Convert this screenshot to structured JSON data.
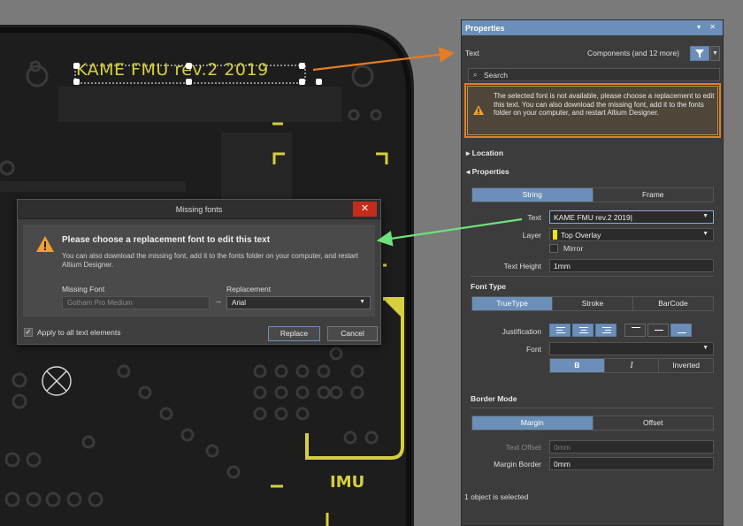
{
  "board": {
    "title_text": "KAME FMU rev.2 2019",
    "imu_label": "IMU"
  },
  "dialog": {
    "title": "Missing fonts",
    "close_glyph": "✕",
    "heading": "Please choose a replacement font to edit this text",
    "message": "You can also download the missing font, add it to the fonts folder on your computer, and restart Altium Designer.",
    "missing_font_label": "Missing Font",
    "missing_font_value": "Gotham Pro Medium",
    "replacement_label": "Replacement",
    "replacement_value": "Arial",
    "apply_all_label": "Apply to all text elements",
    "apply_all_checked": true,
    "replace_button": "Replace",
    "cancel_button": "Cancel"
  },
  "panel": {
    "title": "Properties",
    "header_icons": "▾ ✕",
    "object_type": "Text",
    "filter_label": "Components (and 12 more)",
    "search_placeholder": "Search",
    "warning": "The selected font is not available, please choose a replacement  to edit this text. You can also download the missing font, add it to the fonts folder on your computer, and restart Altium Designer.",
    "location_section": "Location",
    "properties_section": "Properties",
    "tabs_string_frame": [
      "String",
      "Frame"
    ],
    "text_label": "Text",
    "text_value": "KAME FMU rev.2 2019",
    "layer_label": "Layer",
    "layer_value": "Top Overlay",
    "mirror_label": "Mirror",
    "text_height_label": "Text Height",
    "text_height_value": "1mm",
    "font_type_section": "Font Type",
    "font_types": [
      "TrueType",
      "Stroke",
      "BarCode"
    ],
    "justification_label": "Justification",
    "font_label": "Font",
    "font_value": "",
    "bold_label": "B",
    "italic_label": "I",
    "inverted_label": "Inverted",
    "border_mode_section": "Border Mode",
    "border_modes": [
      "Margin",
      "Offset"
    ],
    "text_offset_label": "Text Offset",
    "text_offset_value": "0mm",
    "margin_border_label": "Margin Border",
    "margin_border_value": "0mm",
    "status": "1 object is selected"
  },
  "colors": {
    "accent": "#6b8fb8",
    "silkscreen": "#d7cf3f",
    "callout_orange": "#e77c22",
    "callout_green": "#6fe07a",
    "close_red": "#c42b1c"
  }
}
